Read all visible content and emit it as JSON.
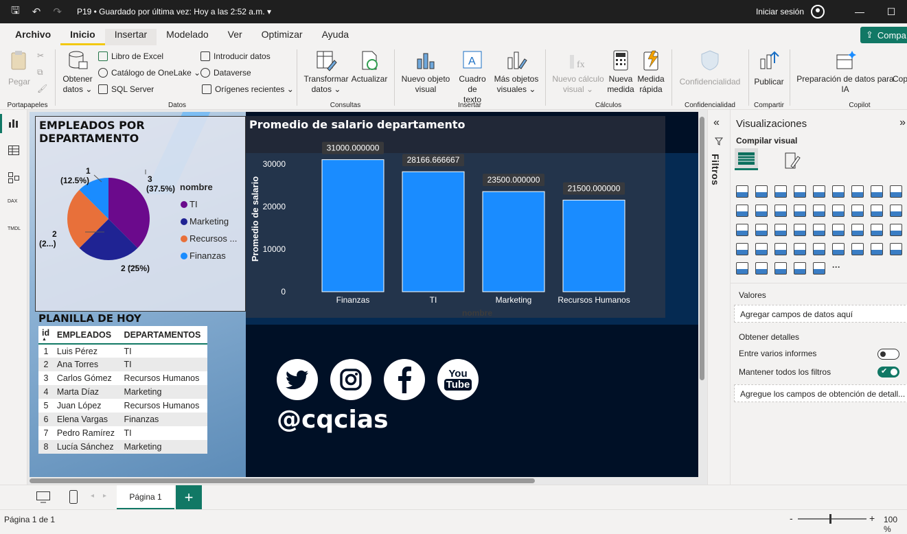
{
  "titlebar": {
    "doc_title": "P19 • Guardado por última vez: Hoy a las 2:52 a.m.",
    "signin": "Iniciar sesión"
  },
  "menu": {
    "tabs": [
      "Archivo",
      "Inicio",
      "Insertar",
      "Modelado",
      "Ver",
      "Optimizar",
      "Ayuda"
    ],
    "share": "Compa"
  },
  "ribbon": {
    "pegar": "Pegar",
    "portapapeles": "Portapapeles",
    "obtener_datos": [
      "Obtener",
      "datos ⌄"
    ],
    "libro_excel": "Libro de Excel",
    "onelake": "Catálogo de OneLake ⌄",
    "sql": "SQL Server",
    "introducir": "Introducir datos",
    "dataverse": "Dataverse",
    "origenes": "Orígenes recientes ⌄",
    "datos_group": "Datos",
    "transformar": [
      "Transformar",
      "datos ⌄"
    ],
    "actualizar": "Actualizar",
    "consultas": "Consultas",
    "nuevo_visual": [
      "Nuevo objeto",
      "visual"
    ],
    "cuadro_texto": [
      "Cuadro de",
      "texto"
    ],
    "mas_visuales": [
      "Más objetos",
      "visuales ⌄"
    ],
    "insertar": "Insertar",
    "nuevo_calculo": [
      "Nuevo cálculo",
      "visual ⌄"
    ],
    "nueva_medida": [
      "Nueva",
      "medida"
    ],
    "medida_rapida": [
      "Medida",
      "rápida"
    ],
    "calculos": "Cálculos",
    "confidencialidad_btn": "Confidencialidad",
    "confidencialidad": "Confidencialidad",
    "publicar": "Publicar",
    "compartir": "Compartir",
    "preparacion": [
      "Preparación de datos para",
      "IA"
    ],
    "copilot_btn": "Cop",
    "copilot": "Copilot"
  },
  "pie": {
    "title": "EMPLEADOS POR DEPARTAMENTO",
    "legend_title": "nombre",
    "legend": [
      {
        "label": "TI",
        "color": "#6b0a8c"
      },
      {
        "label": "Marketing",
        "color": "#1f2393"
      },
      {
        "label": "Recursos ...",
        "color": "#e8703a"
      },
      {
        "label": "Finanzas",
        "color": "#1a8cff"
      }
    ],
    "labels": {
      "ti": [
        "3",
        "(37.5%)"
      ],
      "mk": "2 (25%)",
      "rh": [
        "2",
        "(2...)"
      ],
      "fi": [
        "1",
        "(12.5%)"
      ]
    }
  },
  "chart_data": {
    "type": "bar",
    "title": "Promedio de salario departamento",
    "xlabel": "nombre",
    "ylabel": "Promedio de salario",
    "categories": [
      "Finanzas",
      "TI",
      "Marketing",
      "Recursos Humanos"
    ],
    "values": [
      31000,
      28166.666667,
      23500,
      21500
    ],
    "data_labels": [
      "31000.000000",
      "28166.666667",
      "23500.000000",
      "21500.000000"
    ],
    "yticks": [
      "0",
      "10000",
      "20000",
      "30000"
    ],
    "ylim": [
      0,
      34000
    ],
    "bar_color": "#1a8cff"
  },
  "table": {
    "title": "PLANILLA DE HOY",
    "headers": [
      "id",
      "EMPLEADOS",
      "DEPARTAMENTOS"
    ],
    "rows": [
      [
        "1",
        "Luis Pérez",
        "TI"
      ],
      [
        "2",
        "Ana Torres",
        "TI"
      ],
      [
        "3",
        "Carlos Gómez",
        "Recursos Humanos"
      ],
      [
        "4",
        "Marta Díaz",
        "Marketing"
      ],
      [
        "5",
        "Juan López",
        "Recursos Humanos"
      ],
      [
        "6",
        "Elena Vargas",
        "Finanzas"
      ],
      [
        "7",
        "Pedro Ramírez",
        "TI"
      ],
      [
        "8",
        "Lucía Sánchez",
        "Marketing"
      ]
    ]
  },
  "social": {
    "handle": "@cqcias",
    "youtube": [
      "You",
      "Tube"
    ]
  },
  "filters": {
    "label": "Filtros"
  },
  "vis": {
    "title": "Visualizaciones",
    "compilar": "Compilar visual",
    "valores": "Valores",
    "agregar": "Agregar campos de datos aquí",
    "detalles": "Obtener detalles",
    "entre": "Entre varios informes",
    "mantener": "Mantener todos los filtros",
    "agregue": "Agregue los campos de obtención de detall..."
  },
  "pages": {
    "tab": "Página 1",
    "add": "+"
  },
  "status": {
    "page": "Página 1 de 1",
    "zoom": "100 %"
  }
}
